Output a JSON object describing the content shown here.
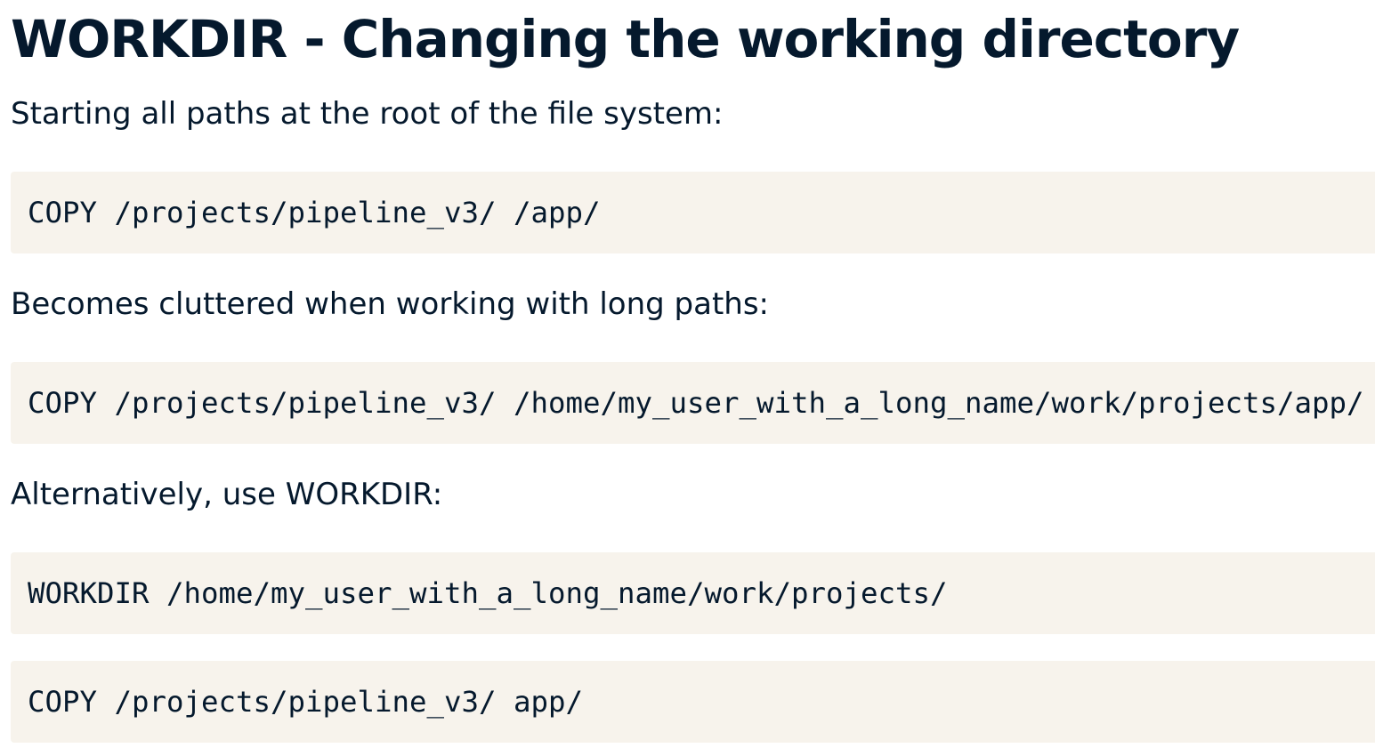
{
  "page": {
    "title": "WORKDIR - Changing the working directory"
  },
  "sections": {
    "intro_text": "Starting all paths at the root of the file system:",
    "code_1": "COPY /projects/pipeline_v3/ /app/",
    "cluttered_text": "Becomes cluttered when working with long paths:",
    "code_2": "COPY /projects/pipeline_v3/ /home/my_user_with_a_long_name/work/projects/app/",
    "alternative_text": "Alternatively, use WORKDIR:",
    "code_3": "WORKDIR /home/my_user_with_a_long_name/work/projects/",
    "code_4": "COPY /projects/pipeline_v3/ app/"
  },
  "colors": {
    "text": "#05192d",
    "code_background": "#f7f3ec",
    "page_background": "#ffffff"
  }
}
